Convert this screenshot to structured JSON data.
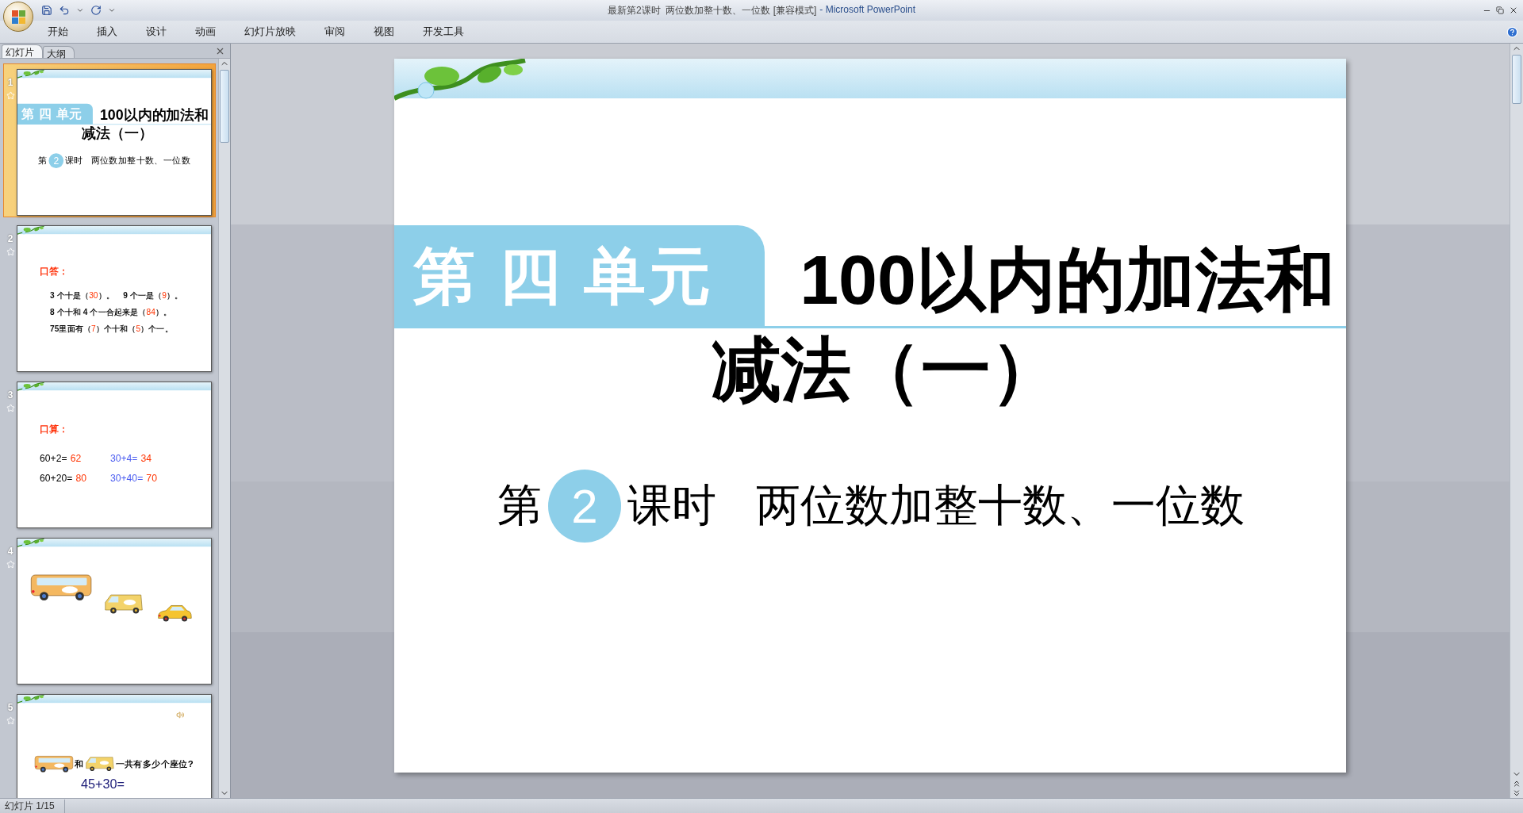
{
  "window": {
    "document_title": "最新第2课时  两位数加整十数、一位数 [兼容模式]",
    "app_name": "- Microsoft PowerPoint"
  },
  "ribbon_tabs": [
    "开始",
    "插入",
    "设计",
    "动画",
    "幻灯片放映",
    "审阅",
    "视图",
    "开发工具"
  ],
  "slides_panel": {
    "tabs": [
      {
        "label": "幻灯片",
        "selected": true
      },
      {
        "label": "大纲",
        "selected": false
      }
    ],
    "slides": [
      {
        "number": "1",
        "selected": true,
        "animated": true,
        "content": {
          "kind": "title",
          "unit": "第 四 单元",
          "title_lines": [
            "100以内的加法和",
            "减法（一）"
          ],
          "lesson_prefix": "第",
          "lesson_number": "2",
          "lesson_suffix": "课时",
          "lesson_title": "两位数加整十数、一位数"
        }
      },
      {
        "number": "2",
        "selected": false,
        "animated": true,
        "content": {
          "kind": "oral",
          "heading": "口答：",
          "lines": [
            [
              {
                "text": "3 个十是（",
                "answer": false
              },
              {
                "text": "30",
                "answer": true
              },
              {
                "text": "）。    9 个一是（",
                "answer": false
              },
              {
                "text": "9",
                "answer": true
              },
              {
                "text": "）。",
                "answer": false
              }
            ],
            [
              {
                "text": "8 个十和 4 个一合起来是（",
                "answer": false
              },
              {
                "text": "84",
                "answer": true
              },
              {
                "text": "）。",
                "answer": false
              }
            ],
            [
              {
                "text": "75里面有（",
                "answer": false
              },
              {
                "text": "7",
                "answer": true
              },
              {
                "text": "）个十和（",
                "answer": false
              },
              {
                "text": "5",
                "answer": true
              },
              {
                "text": "）个一。",
                "answer": false
              }
            ]
          ]
        }
      },
      {
        "number": "3",
        "selected": false,
        "animated": true,
        "content": {
          "kind": "calc",
          "heading": "口算：",
          "equations": [
            {
              "question": "60+2=",
              "answer": "62",
              "color": "#000000"
            },
            {
              "question": "30+4=",
              "answer": "34",
              "color": "#4a5cf0"
            },
            {
              "question": "60+20=",
              "answer": "80",
              "color": "#000000"
            },
            {
              "question": "30+40=",
              "answer": "70",
              "color": "#4a5cf0"
            }
          ]
        }
      },
      {
        "number": "4",
        "selected": false,
        "animated": true,
        "content": {
          "kind": "vehicles"
        }
      },
      {
        "number": "5",
        "selected": false,
        "animated": true,
        "content": {
          "kind": "question",
          "connector": "和",
          "question": "一共有多少个座位?",
          "equation": "45+30="
        }
      }
    ]
  },
  "editor": {
    "slide": {
      "kind": "title",
      "unit": "第 四 单元",
      "title_lines": [
        "100以内的加法和",
        "减法（一）"
      ],
      "lesson_prefix": "第",
      "lesson_number": "2",
      "lesson_suffix": "课时",
      "lesson_title": "两位数加整十数、一位数"
    }
  },
  "status_bar": {
    "slide_indicator": "幻灯片 1/15"
  }
}
